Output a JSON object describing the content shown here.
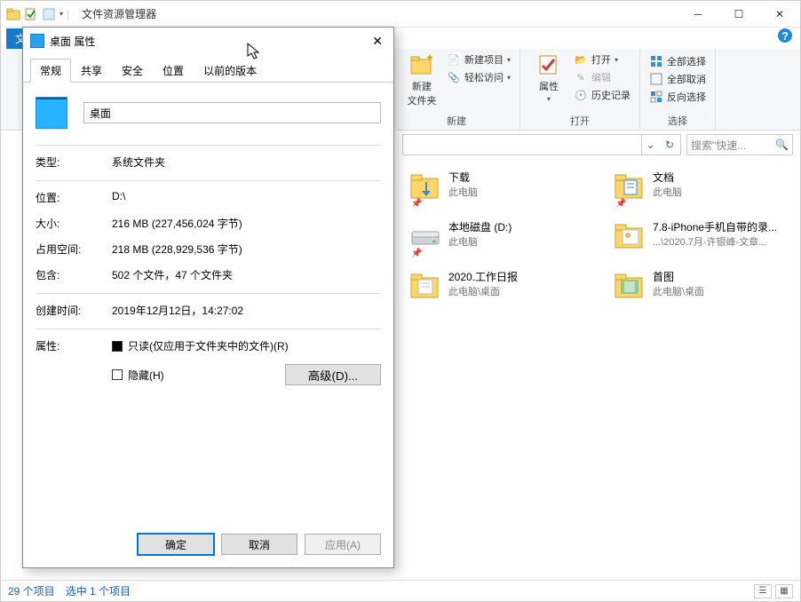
{
  "window": {
    "title": "文件资源管理器"
  },
  "ribbon": {
    "file_tab": "文",
    "group_new": {
      "title": "新建",
      "new_folder": "新建\n文件夹",
      "new_item": "新建项目",
      "easy_access": "轻松访问"
    },
    "group_open": {
      "title": "打开",
      "properties": "属性",
      "open": "打开",
      "edit": "编辑",
      "history": "历史记录"
    },
    "group_select": {
      "title": "选择",
      "select_all": "全部选择",
      "select_none": "全部取消",
      "invert": "反向选择"
    }
  },
  "search": {
    "placeholder": "搜索\"快速..."
  },
  "items": [
    {
      "name": "下载",
      "sub": "此电脑",
      "pinned": true,
      "icon": "download-folder"
    },
    {
      "name": "文档",
      "sub": "此电脑",
      "pinned": true,
      "icon": "docs-folder"
    },
    {
      "name": "本地磁盘 (D:)",
      "sub": "此电脑",
      "pinned": true,
      "icon": "drive"
    },
    {
      "name": "7.8-iPhone手机自带的录...",
      "sub": "...\\2020.7月-许银峰-文章...",
      "pinned": false,
      "icon": "folder-pics"
    },
    {
      "name": "2020.工作日报",
      "sub": "此电脑\\桌面",
      "pinned": false,
      "icon": "folder-docs"
    },
    {
      "name": "首图",
      "sub": "此电脑\\桌面",
      "pinned": false,
      "icon": "folder-pics2"
    }
  ],
  "statusbar": {
    "count": "29 个项目",
    "selected": "选中 1 个项目"
  },
  "props": {
    "title": "桌面 属性",
    "tabs": {
      "general": "常规",
      "share": "共享",
      "security": "安全",
      "location": "位置",
      "prev": "以前的版本"
    },
    "folder_name": "桌面",
    "rows": {
      "type_label": "类型:",
      "type_val": "系统文件夹",
      "loc_label": "位置:",
      "loc_val": "D:\\",
      "size_label": "大小:",
      "size_val": "216 MB (227,456,024 字节)",
      "ondisk_label": "占用空间:",
      "ondisk_val": "218 MB (228,929,536 字节)",
      "contains_label": "包含:",
      "contains_val": "502 个文件，47 个文件夹",
      "created_label": "创建时间:",
      "created_val": "2019年12月12日，14:27:02",
      "attr_label": "属性:",
      "readonly": "只读(仅应用于文件夹中的文件)(R)",
      "hidden": "隐藏(H)",
      "advanced": "高级(D)..."
    },
    "buttons": {
      "ok": "确定",
      "cancel": "取消",
      "apply": "应用(A)"
    }
  }
}
